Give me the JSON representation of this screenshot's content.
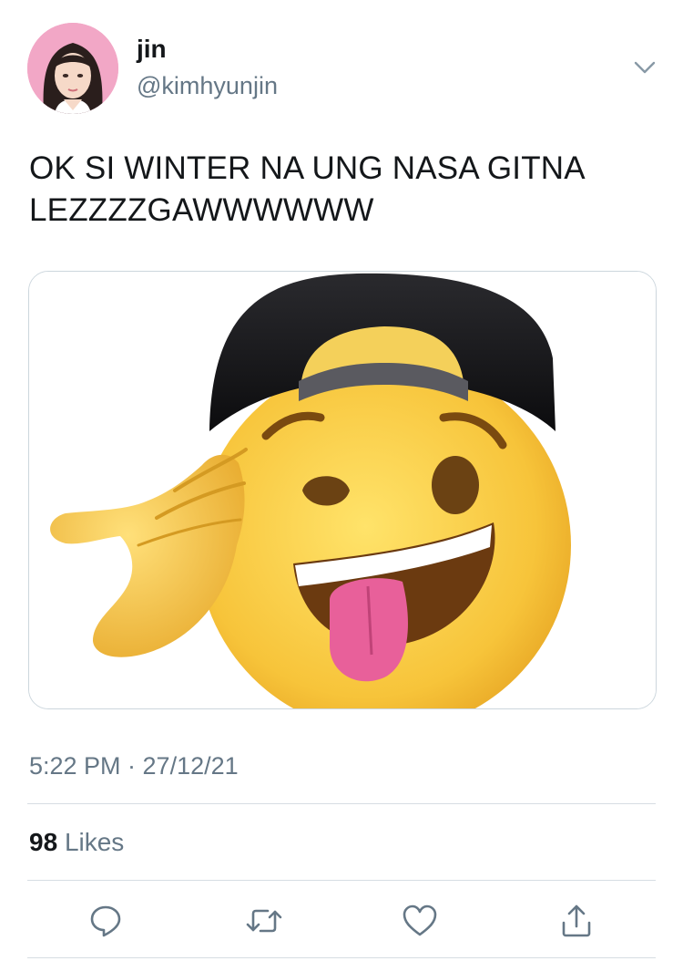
{
  "user": {
    "display_name": "jin",
    "handle": "@kimhyunjin"
  },
  "tweet": {
    "text_line1": "OK SI WINTER NA UNG NASA GITNA",
    "text_line2": "LEZZZZGAWWWWWW",
    "timestamp": "5:22 PM · 27/12/21"
  },
  "stats": {
    "likes_count": "98",
    "likes_label": "Likes"
  },
  "icons": {
    "caret": "chevron-down-icon",
    "reply": "reply-icon",
    "retweet": "retweet-icon",
    "like": "heart-icon",
    "share": "share-icon"
  },
  "colors": {
    "text_primary": "#14171a",
    "text_secondary": "#657786",
    "border": "#ccd6dd",
    "avatar_bg": "#f2a7c6"
  }
}
